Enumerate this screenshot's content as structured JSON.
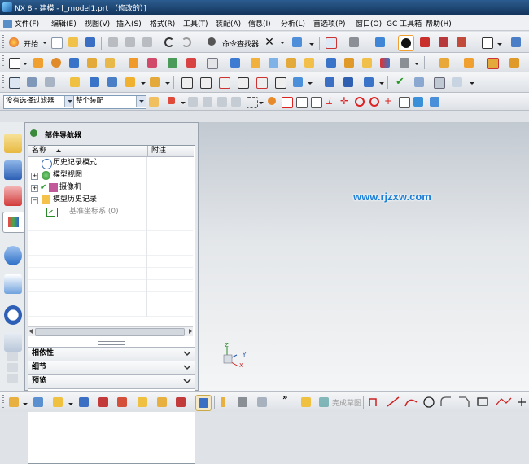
{
  "window": {
    "title": "NX 8 - 建模 - [_model1.prt （修改的）]"
  },
  "menubar": {
    "items": [
      "文件(F)",
      "编辑(E)",
      "视图(V)",
      "插入(S)",
      "格式(R)",
      "工具(T)",
      "装配(A)",
      "信息(I)",
      "分析(L)",
      "首选项(P)",
      "窗口(O)",
      "GC 工具箱",
      "帮助(H)"
    ]
  },
  "toolbar": {
    "start_label": "开始",
    "command_finder_label": "命令查找器"
  },
  "selection_bar": {
    "filter_value": "没有选择过滤器",
    "scope_value": "整个装配"
  },
  "navigator": {
    "title": "部件导航器",
    "columns": [
      "名称",
      "附注"
    ],
    "items": [
      {
        "label": "历史记录模式",
        "icon": "history-clock-icon"
      },
      {
        "label": "模型视图",
        "icon": "model-views-icon"
      },
      {
        "label": "摄像机",
        "icon": "camera-icon"
      },
      {
        "label": "模型历史记录",
        "icon": "folder-icon"
      },
      {
        "label": "基准坐标系 (0)",
        "icon": "datum-csys-icon"
      }
    ],
    "sections": [
      "相依性",
      "细节",
      "预览"
    ]
  },
  "graphics": {
    "watermark": "www.rjzxw.com",
    "triad_labels": {
      "z": "Z",
      "y": "Y",
      "x": "X"
    }
  },
  "sketch_toolbar": {
    "finish_label": "完成草图"
  },
  "colors": {
    "titlebar": "#1e4677",
    "watermark": "#1e7fd6",
    "accent_blue": "#2f6fcf",
    "accent_red": "#d22a2a",
    "check_green": "#2a9a2a"
  }
}
